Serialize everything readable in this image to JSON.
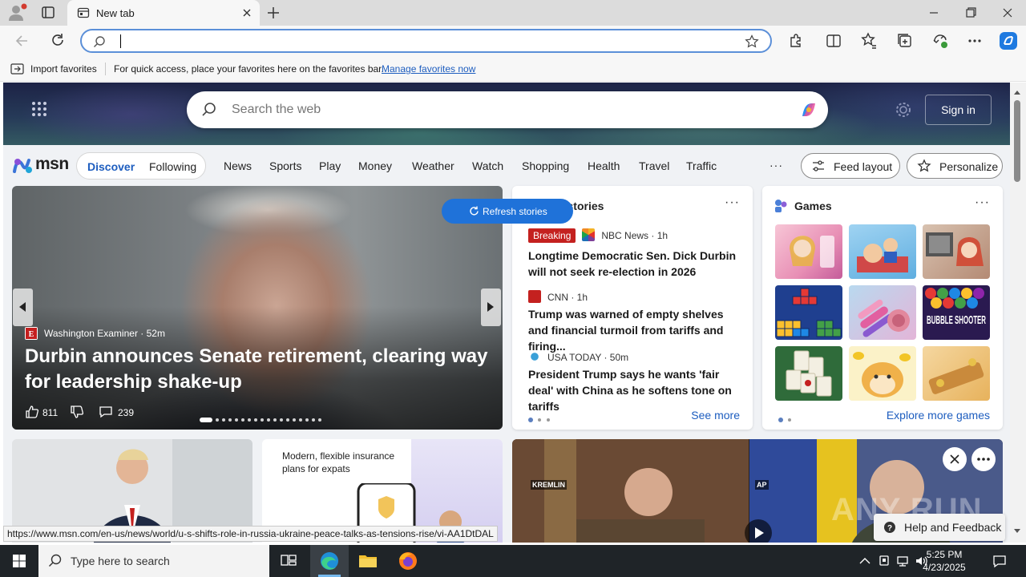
{
  "browser": {
    "tab_title": "New tab",
    "favorites": {
      "import_label": "Import favorites",
      "hint": "For quick access, place your favorites here on the favorites bar.",
      "manage_link": "Manage favorites now"
    }
  },
  "msn": {
    "search_placeholder": "Search the web",
    "sign_in": "Sign in",
    "logo_text": "msn",
    "tabs": {
      "discover": "Discover",
      "following": "Following"
    },
    "nav": [
      "News",
      "Sports",
      "Play",
      "Money",
      "Weather",
      "Watch",
      "Shopping",
      "Health",
      "Travel",
      "Traffic"
    ],
    "more": "···",
    "feed_layout": "Feed layout",
    "personalize": "Personalize",
    "refresh": "Refresh stories"
  },
  "main_story": {
    "source": "Washington Examiner · 52m",
    "headline": "Durbin announces Senate retirement, clearing way for leadership shake-up",
    "likes": "811",
    "comments": "239"
  },
  "top_stories": {
    "title": "Top stories",
    "items": [
      {
        "badge": "Breaking",
        "source": "NBC News · 1h",
        "title": "Longtime Democratic Sen. Dick Durbin will not seek re-election in 2026"
      },
      {
        "source": "CNN · 1h",
        "title": "Trump was warned of empty shelves and financial turmoil from tariffs and firing..."
      },
      {
        "source": "USA TODAY · 50m",
        "title": "President Trump says he wants 'fair deal' with China as he softens tone on tariffs"
      }
    ],
    "see_more": "See more"
  },
  "games": {
    "title": "Games",
    "explore": "Explore more games",
    "bubble_label": "BUBBLE SHOOTER"
  },
  "promo": {
    "text": "Modern, flexible insurance plans for expats"
  },
  "video": {
    "label_left": "KREMLIN",
    "label_right": "AP"
  },
  "status_url": "https://www.msn.com/en-us/news/world/u-s-shifts-role-in-russia-ukraine-peace-talks-as-tensions-rise/vi-AA1DtDAL",
  "help": "Help and Feedback",
  "watermark": "ANY RUN",
  "taskbar": {
    "search_placeholder": "Type here to search",
    "time": "5:25 PM",
    "date": "4/23/2025"
  }
}
